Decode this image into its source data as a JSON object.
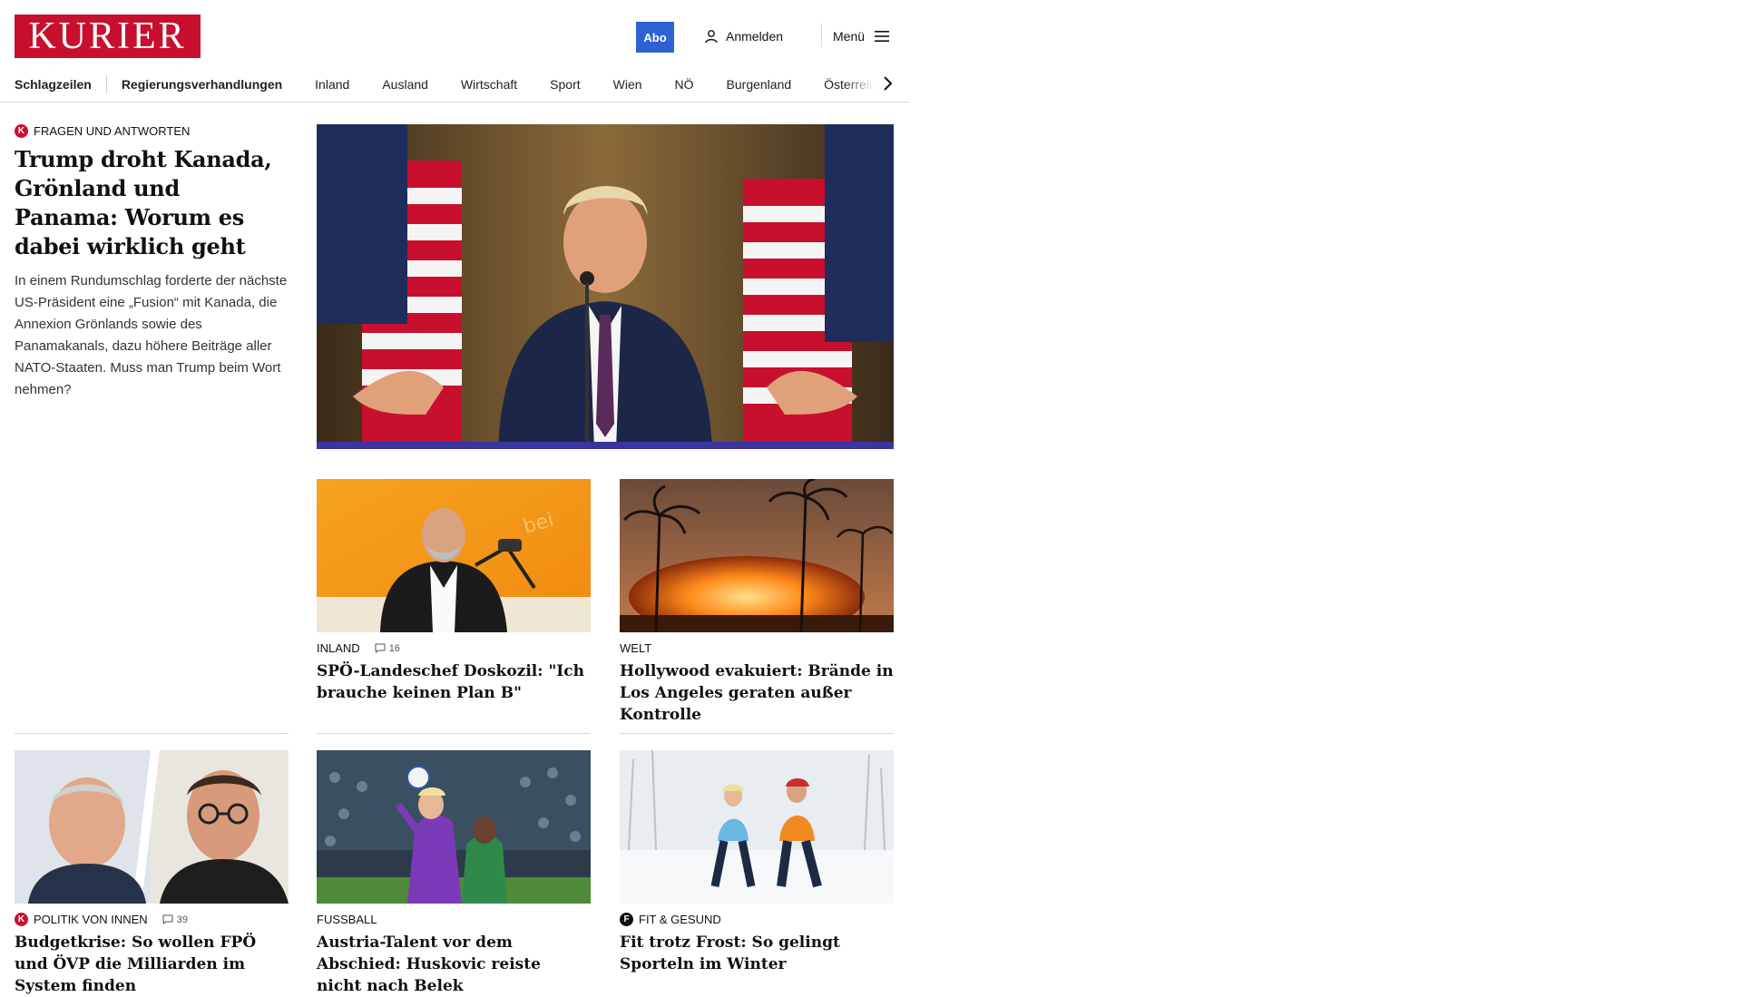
{
  "header": {
    "logo": "KURIER",
    "abo_label": "Abo",
    "login_label": "Anmelden",
    "menu_label": "Menü"
  },
  "nav": {
    "items": [
      "Schlagzeilen",
      "Regierungsverhandlungen",
      "Inland",
      "Ausland",
      "Wirtschaft",
      "Sport",
      "Wien",
      "NÖ",
      "Burgenland",
      "Österreich"
    ]
  },
  "lead": {
    "kicker": "FRAGEN UND ANTWORTEN",
    "title": "Trump droht Kanada, Grönland und Panama: Worum es dabei wirklich geht",
    "teaser": "In einem Rundumschlag forderte der nächste US-Präsident eine „Fusion“ mit Kanada, die Annexion Grönlands sowie des Panamakanals, dazu höhere Beiträge aller NATO-Staaten. Muss man Trump beim Wort nehmen?"
  },
  "cards": [
    {
      "kicker": "INLAND",
      "comments": "16",
      "title": "SPÖ-Landeschef Doskozil: \"Ich brauche keinen Plan B\""
    },
    {
      "kicker": "WELT",
      "title": "Hollywood evakuiert: Brände in Los Angeles geraten außer Kontrolle"
    },
    {
      "kicker": "POLITIK VON INNEN",
      "comments": "39",
      "title": "Budgetkrise: So wollen FPÖ und ÖVP die Milliarden im System finden"
    },
    {
      "kicker": "FUSSBALL",
      "title": "Austria-Talent vor dem Abschied: Huskovic reiste nicht nach Belek"
    },
    {
      "kicker": "FIT & GESUND",
      "title": "Fit trotz Frost: So gelingt Sporteln im Winter"
    }
  ],
  "colors": {
    "brand": "#c8102e",
    "abo": "#2d62d2"
  },
  "icons": [
    "user-icon",
    "hamburger-icon",
    "chevron-right-icon",
    "comment-icon",
    "kurier-k-icon",
    "fit-gesund-icon"
  ]
}
